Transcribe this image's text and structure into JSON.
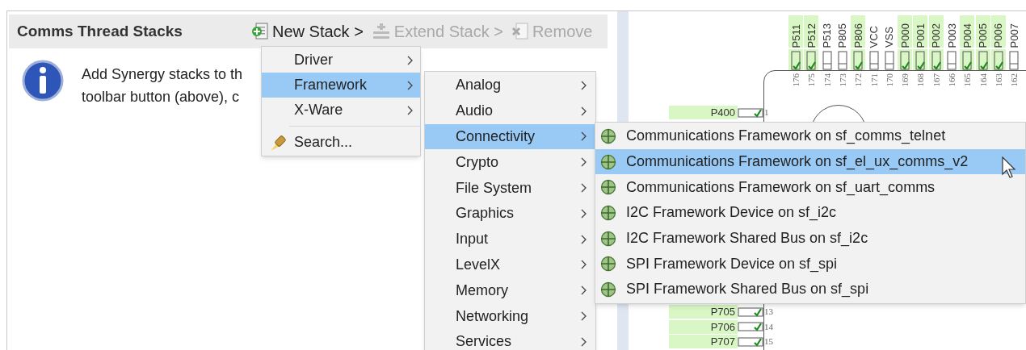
{
  "panel": {
    "title": "Comms Thread Stacks",
    "toolbar": [
      {
        "kind": "new",
        "label": "New Stack >",
        "disabled": false
      },
      {
        "kind": "extend",
        "label": "Extend Stack >",
        "disabled": true
      },
      {
        "kind": "remove",
        "label": "Remove",
        "disabled": true
      }
    ],
    "info_lines": [
      "Add Synergy stacks to th",
      "toolbar button (above), c"
    ]
  },
  "menu": {
    "items": [
      {
        "kind": "submenu",
        "label": "Driver",
        "selected": false
      },
      {
        "kind": "submenu",
        "label": "Framework",
        "selected": true
      },
      {
        "kind": "submenu",
        "label": "X-Ware",
        "selected": false
      },
      {
        "kind": "search",
        "label": "Search...",
        "selected": false
      }
    ]
  },
  "submenu": {
    "items": [
      {
        "label": "Analog",
        "selected": false
      },
      {
        "label": "Audio",
        "selected": false
      },
      {
        "label": "Connectivity",
        "selected": true
      },
      {
        "label": "Crypto",
        "selected": false
      },
      {
        "label": "File System",
        "selected": false
      },
      {
        "label": "Graphics",
        "selected": false
      },
      {
        "label": "Input",
        "selected": false
      },
      {
        "label": "LevelX",
        "selected": false
      },
      {
        "label": "Memory",
        "selected": false
      },
      {
        "label": "Networking",
        "selected": false
      },
      {
        "label": "Services",
        "selected": false
      }
    ]
  },
  "stack_menu": {
    "items": [
      {
        "label": "Communications Framework on sf_comms_telnet",
        "selected": false
      },
      {
        "label": "Communications Framework on sf_el_ux_comms_v2",
        "selected": true
      },
      {
        "label": "Communications Framework on sf_uart_comms",
        "selected": false
      },
      {
        "label": "I2C Framework Device on sf_i2c",
        "selected": false
      },
      {
        "label": "I2C Framework Shared Bus on sf_i2c",
        "selected": false
      },
      {
        "label": "SPI Framework Device on sf_spi",
        "selected": false
      },
      {
        "label": "SPI Framework Shared Bus on sf_spi",
        "selected": false
      }
    ]
  },
  "pin_diagram": {
    "top_pins": [
      {
        "name": "P511",
        "number": "176",
        "checked": true
      },
      {
        "name": "P512",
        "number": "175",
        "checked": true
      },
      {
        "name": "P513",
        "number": "174",
        "checked": false
      },
      {
        "name": "P805",
        "number": "173",
        "checked": false
      },
      {
        "name": "P806",
        "number": "172",
        "checked": true
      },
      {
        "name": "VCC",
        "number": "171",
        "checked": false
      },
      {
        "name": "VSS",
        "number": "170",
        "checked": false
      },
      {
        "name": "P000",
        "number": "169",
        "checked": true
      },
      {
        "name": "P001",
        "number": "168",
        "checked": true
      },
      {
        "name": "P002",
        "number": "167",
        "checked": true
      },
      {
        "name": "P003",
        "number": "166",
        "checked": false
      },
      {
        "name": "P004",
        "number": "165",
        "checked": true
      },
      {
        "name": "P005",
        "number": "164",
        "checked": true
      },
      {
        "name": "P006",
        "number": "163",
        "checked": true
      },
      {
        "name": "P007",
        "number": "162",
        "checked": false
      }
    ],
    "left_pins_top": [
      {
        "name": "P400",
        "number": "1",
        "checked": true
      }
    ],
    "left_pins_bottom": [
      {
        "name": "P705",
        "number": "13",
        "checked": true
      },
      {
        "name": "P706",
        "number": "14",
        "checked": true
      },
      {
        "name": "P707",
        "number": "15",
        "checked": true
      }
    ]
  }
}
